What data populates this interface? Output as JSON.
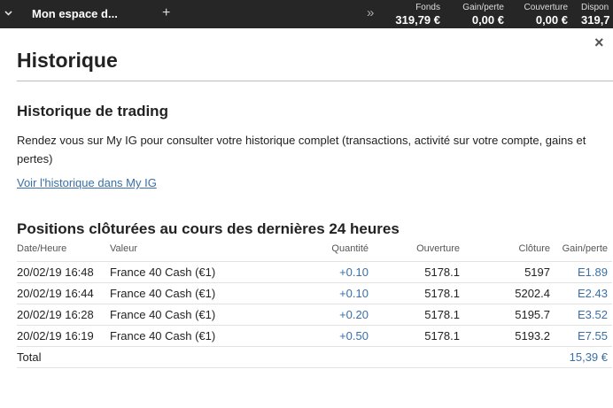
{
  "topbar": {
    "workspace_tab": "Mon espace d...",
    "add_tab": "+",
    "metrics": [
      {
        "label": "Fonds",
        "value": "319,79 €"
      },
      {
        "label": "Gain/perte",
        "value": "0,00 €"
      },
      {
        "label": "Couverture",
        "value": "0,00 €"
      },
      {
        "label": "Dispon",
        "value": "319,7"
      }
    ]
  },
  "panel": {
    "close": "×",
    "title": "Historique",
    "trading": {
      "heading": "Historique de trading",
      "description": "Rendez vous sur My IG pour consulter votre historique complet (transactions, activité sur votre compte, gains et pertes)",
      "link": "Voir l'historique dans My IG"
    },
    "positions": {
      "heading": "Positions clôturées au cours des dernières 24 heures",
      "columns": [
        "Date/Heure",
        "Valeur",
        "Quantité",
        "Ouverture",
        "Clôture",
        "Gain/perte"
      ],
      "rows": [
        {
          "date": "20/02/19 16:48",
          "valeur": "France 40 Cash (€1)",
          "quantite": "+0.10",
          "ouverture": "5178.1",
          "cloture": "5197",
          "gain": "E1.89"
        },
        {
          "date": "20/02/19 16:44",
          "valeur": "France 40 Cash (€1)",
          "quantite": "+0.10",
          "ouverture": "5178.1",
          "cloture": "5202.4",
          "gain": "E2.43"
        },
        {
          "date": "20/02/19 16:28",
          "valeur": "France 40 Cash (€1)",
          "quantite": "+0.20",
          "ouverture": "5178.1",
          "cloture": "5195.7",
          "gain": "E3.52"
        },
        {
          "date": "20/02/19 16:19",
          "valeur": "France 40 Cash (€1)",
          "quantite": "+0.50",
          "ouverture": "5178.1",
          "cloture": "5193.2",
          "gain": "E7.55"
        }
      ],
      "total_label": "Total",
      "total_value": "15,39 €"
    }
  },
  "colors": {
    "topbar_bg": "#262626",
    "link": "#3a6fa8",
    "positive": "#3a6fa8"
  },
  "icons": {
    "collapse": "chevron-down-icon",
    "more": "double-chevron-right-icon",
    "close": "close-icon"
  }
}
